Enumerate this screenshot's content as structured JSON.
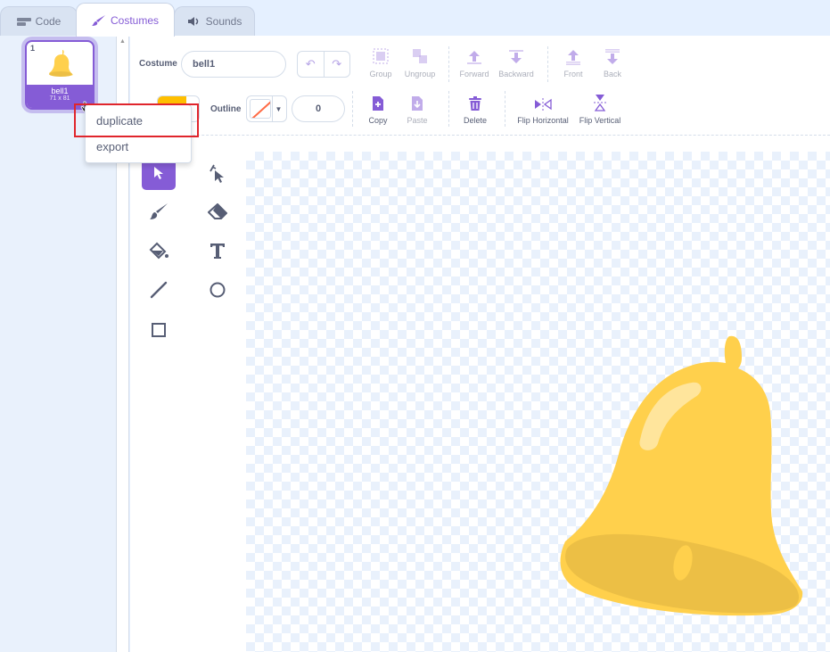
{
  "tabs": [
    {
      "label": "Code",
      "icon": "code-icon",
      "active": false
    },
    {
      "label": "Costumes",
      "icon": "paintbrush-icon",
      "active": true
    },
    {
      "label": "Sounds",
      "icon": "speaker-icon",
      "active": false
    }
  ],
  "costume_list": {
    "items": [
      {
        "number": "1",
        "name": "bell1",
        "size": "71 x 81",
        "selected": true
      }
    ]
  },
  "context_menu": {
    "items": [
      {
        "label": "duplicate",
        "highlighted": true
      },
      {
        "label": "export",
        "highlighted": false
      }
    ]
  },
  "editor": {
    "costume_label": "Costume",
    "costume_name": "bell1",
    "fill_color": "#ffbf00",
    "outline_label": "Outline",
    "outline_width": "0",
    "toolbar_top": [
      {
        "label": "Group",
        "disabled": true
      },
      {
        "label": "Ungroup",
        "disabled": true
      },
      {
        "label": "Forward",
        "disabled": true
      },
      {
        "label": "Backward",
        "disabled": true
      },
      {
        "label": "Front",
        "disabled": true
      },
      {
        "label": "Back",
        "disabled": true
      }
    ],
    "toolbar_bottom": [
      {
        "label": "Copy",
        "disabled": false
      },
      {
        "label": "Paste",
        "disabled": true
      },
      {
        "label": "Delete",
        "disabled": false
      },
      {
        "label": "Flip Horizontal",
        "disabled": false
      },
      {
        "label": "Flip Vertical",
        "disabled": false
      }
    ],
    "tools": [
      "select-tool",
      "reshape-tool",
      "brush-tool",
      "eraser-tool",
      "fill-tool",
      "text-tool",
      "line-tool",
      "circle-tool",
      "rectangle-tool"
    ],
    "selected_tool": "select-tool"
  },
  "colors": {
    "accent": "#855cd6",
    "highlight_box": "#e0252c",
    "bell_body": "#ffd04c",
    "bell_shade": "#ecbf45"
  }
}
